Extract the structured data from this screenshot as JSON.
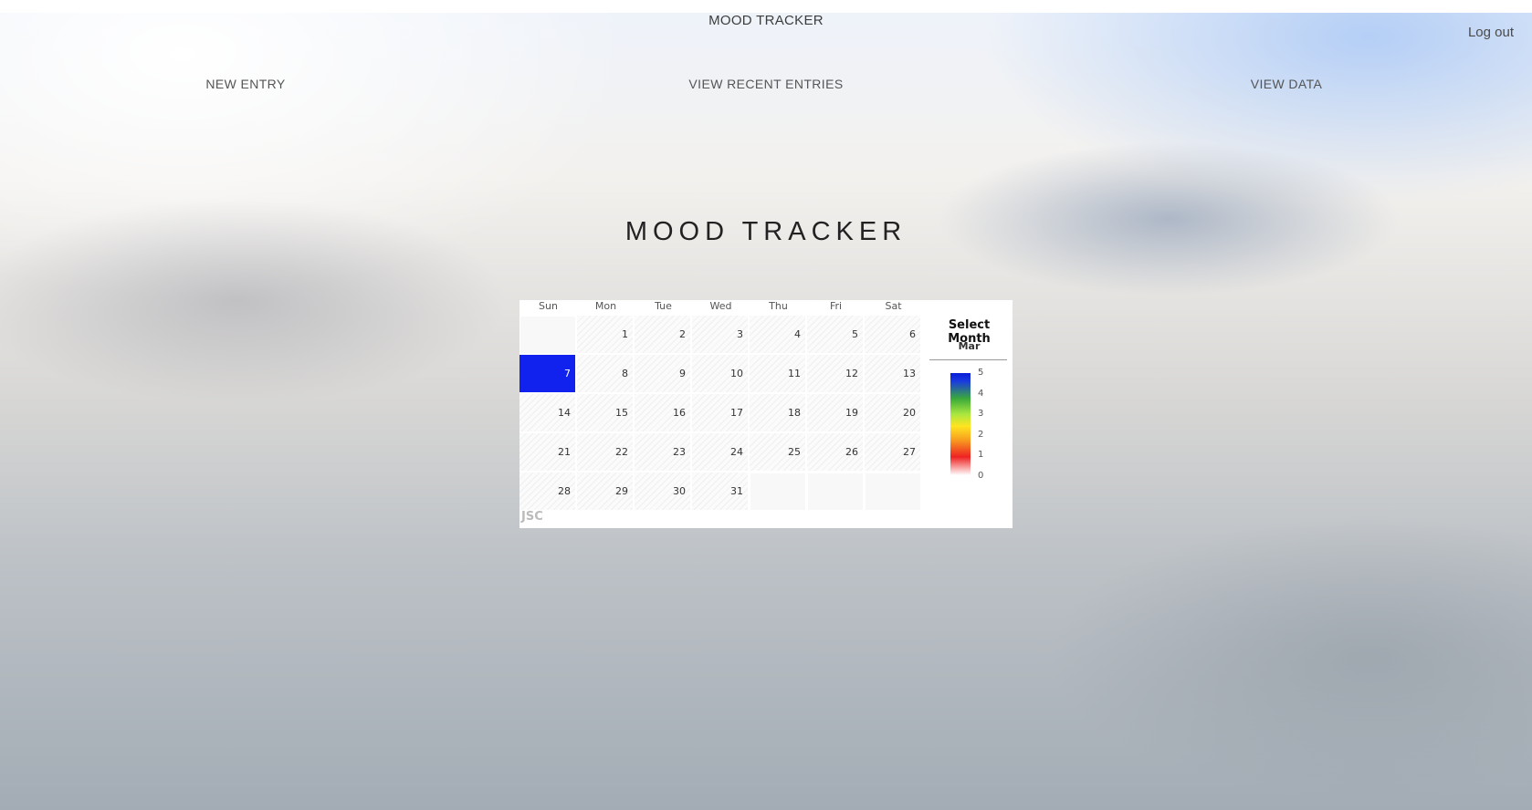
{
  "header": {
    "title": "MOOD TRACKER",
    "logout": "Log out"
  },
  "nav": {
    "new_entry": "NEW ENTRY",
    "recent": "VIEW RECENT ENTRIES",
    "data": "VIEW DATA"
  },
  "page_title": "MOOD TRACKER",
  "calendar": {
    "weekdays": [
      "Sun",
      "Mon",
      "Tue",
      "Wed",
      "Thu",
      "Fri",
      "Sat"
    ],
    "selector_title": "Select Month",
    "selected_month": "Mar",
    "legend_ticks": [
      "5",
      "4",
      "3",
      "2",
      "1",
      "0"
    ],
    "watermark": "JSC",
    "leading_blank_days": 1,
    "days_in_month": 31,
    "mood_entries": [
      {
        "day": 7,
        "mood": 5
      }
    ],
    "filled_color": "#1122ee"
  }
}
